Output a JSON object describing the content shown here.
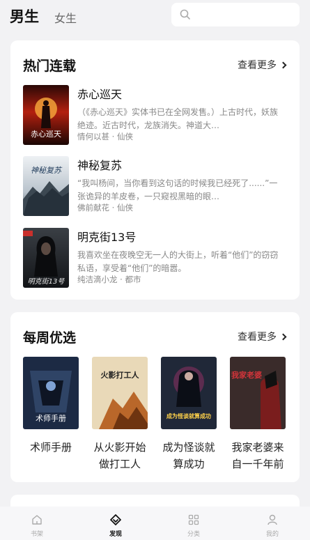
{
  "header": {
    "tab_male": "男生",
    "tab_female": "女生",
    "search_placeholder": ""
  },
  "hot_serial": {
    "title": "热门连载",
    "more_label": "查看更多",
    "books": [
      {
        "title": "赤心巡天",
        "desc": "（《赤心巡天》实体书已在全网发售。）上古时代，妖族绝迹。近古时代，龙族消失。神道大…",
        "meta": "情何以甚 · 仙侠",
        "cover_text": "赤心巡天"
      },
      {
        "title": "神秘复苏",
        "desc": "“我叫杨间，当你看到这句话的时候我已经死了......”一张诡异的羊皮卷，一只窥视黑暗的眼…",
        "meta": "佛前献花 · 仙侠",
        "cover_text": "神秘复苏"
      },
      {
        "title": "明克街13号",
        "desc": "我喜欢坐在夜晚空无一人的大街上，听着“他们”的窃窃私语，享受着“他们”的暗嚣。",
        "meta": "纯洁滴小龙 · 都市",
        "cover_text": "明克街13号"
      }
    ]
  },
  "weekly": {
    "title": "每周优选",
    "more_label": "查看更多",
    "books": [
      {
        "title": "术师手册",
        "cover_text": "术师手册"
      },
      {
        "title": "从火影开始做打工人",
        "cover_text": "火影打工人"
      },
      {
        "title": "成为怪谈就算成功",
        "cover_text": "成为怪谈就算成功"
      },
      {
        "title": "我家老婆来自一千年前",
        "cover_text": "我家老婆"
      }
    ]
  },
  "tabbar": {
    "items": [
      {
        "label": "书架",
        "icon": "bookshelf-icon",
        "active": false
      },
      {
        "label": "发现",
        "icon": "discover-icon",
        "active": true
      },
      {
        "label": "分类",
        "icon": "category-icon",
        "active": false
      },
      {
        "label": "我的",
        "icon": "profile-icon",
        "active": false
      }
    ]
  },
  "colors": {
    "background": "#f2f2f4",
    "card": "#ffffff",
    "muted_text": "#888888",
    "active_tab": "#111111"
  }
}
